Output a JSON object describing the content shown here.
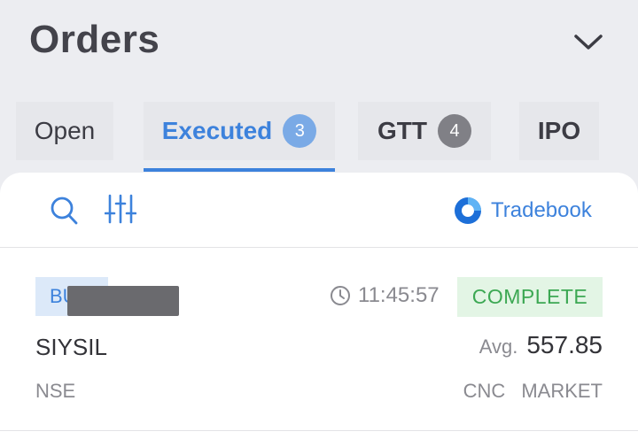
{
  "header": {
    "title": "Orders",
    "collapse_icon": "chevron-down-icon"
  },
  "tabs": [
    {
      "label": "Open"
    },
    {
      "label": "Executed",
      "badge": "3",
      "active": true
    },
    {
      "label": "GTT",
      "badge": "4"
    },
    {
      "label": "IPO"
    }
  ],
  "toolbar": {
    "search_icon": "search-icon",
    "filter_icon": "sliders-icon",
    "tradebook_label": "Tradebook"
  },
  "orders": [
    {
      "side": "BUY",
      "time": "11:45:57",
      "status": "COMPLETE",
      "symbol": "SIYSIL",
      "avg_label": "Avg.",
      "avg_price": "557.85",
      "exchange": "NSE",
      "product": "CNC",
      "order_type": "MARKET"
    }
  ],
  "colors": {
    "accent": "#3d82dc",
    "background": "#ecedf1",
    "complete_text": "#3ca853",
    "complete_bg": "#e3f5e5"
  }
}
